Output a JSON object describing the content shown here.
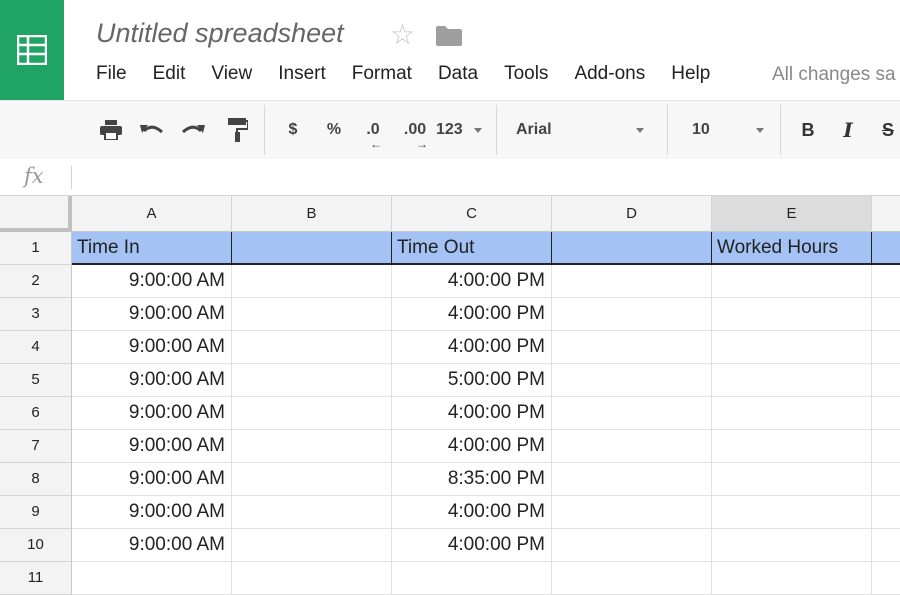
{
  "header": {
    "title": "Untitled spreadsheet",
    "star_icon": "star-icon",
    "folder_icon": "folder-icon",
    "save_status": "All changes sa",
    "logo_color": "#1fa463"
  },
  "menu": [
    "File",
    "Edit",
    "View",
    "Insert",
    "Format",
    "Data",
    "Tools",
    "Add-ons",
    "Help"
  ],
  "toolbar": {
    "currency": "$",
    "percent": "%",
    "decrease_decimal": ".0",
    "increase_decimal": ".00",
    "more_formats": "123",
    "font": "Arial",
    "font_size": "10",
    "bold": "B",
    "italic": "I",
    "strikethrough": "S"
  },
  "formula_bar": {
    "label": "fx",
    "value": ""
  },
  "grid": {
    "columns": [
      "A",
      "B",
      "C",
      "D",
      "E"
    ],
    "selected_column": "E",
    "header_fill": "#a4c2f4",
    "rows": [
      {
        "n": "1",
        "A": "Time In",
        "B": "",
        "C": "Time Out",
        "D": "",
        "E": "Worked Hours"
      },
      {
        "n": "2",
        "A": "9:00:00 AM",
        "B": "",
        "C": "4:00:00 PM",
        "D": "",
        "E": ""
      },
      {
        "n": "3",
        "A": "9:00:00 AM",
        "B": "",
        "C": "4:00:00 PM",
        "D": "",
        "E": ""
      },
      {
        "n": "4",
        "A": "9:00:00 AM",
        "B": "",
        "C": "4:00:00 PM",
        "D": "",
        "E": ""
      },
      {
        "n": "5",
        "A": "9:00:00 AM",
        "B": "",
        "C": "5:00:00 PM",
        "D": "",
        "E": ""
      },
      {
        "n": "6",
        "A": "9:00:00 AM",
        "B": "",
        "C": "4:00:00 PM",
        "D": "",
        "E": ""
      },
      {
        "n": "7",
        "A": "9:00:00 AM",
        "B": "",
        "C": "4:00:00 PM",
        "D": "",
        "E": ""
      },
      {
        "n": "8",
        "A": "9:00:00 AM",
        "B": "",
        "C": "8:35:00 PM",
        "D": "",
        "E": ""
      },
      {
        "n": "9",
        "A": "9:00:00 AM",
        "B": "",
        "C": "4:00:00 PM",
        "D": "",
        "E": ""
      },
      {
        "n": "10",
        "A": "9:00:00 AM",
        "B": "",
        "C": "4:00:00 PM",
        "D": "",
        "E": ""
      },
      {
        "n": "11",
        "A": "",
        "B": "",
        "C": "",
        "D": "",
        "E": ""
      }
    ]
  }
}
